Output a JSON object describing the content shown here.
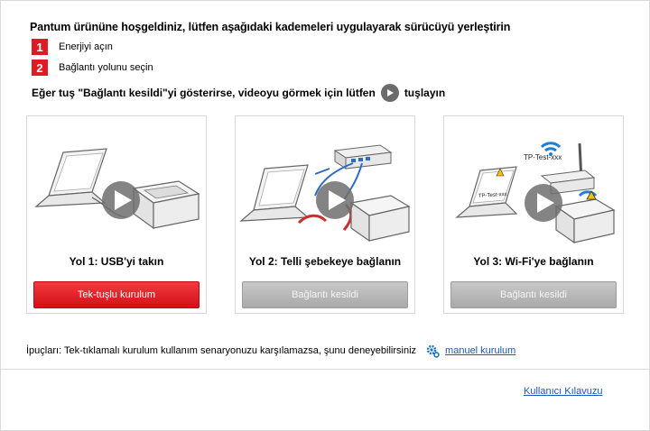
{
  "header": {
    "welcome": "Pantum ürününe hoşgeldiniz, lütfen aşağıdaki kademeleri uygulayarak sürücüyü  yerleştirin",
    "steps": [
      {
        "num": "1",
        "label": "Enerjiyi açın"
      },
      {
        "num": "2",
        "label": "Bağlantı yolunu seçin"
      }
    ],
    "note_before": "Eğer tuş \"Bağlantı kesildi\"yi gösterirse, videoyu görmek için lütfen",
    "note_after": "tuşlayın"
  },
  "cards": [
    {
      "title": "Yol 1: USB'yi takın",
      "button": "Tek-tuşlu kurulum",
      "state": "active"
    },
    {
      "title": "Yol 2: Telli şebekeye bağlanın",
      "button": "Bağlantı kesildi",
      "state": "disabled"
    },
    {
      "title": "Yol 3: Wi-Fi'ye bağlanın",
      "button": "Bağlantı kesildi",
      "state": "disabled",
      "router_label": "TP-Test-xxx",
      "laptop_screen_label": "TP-Test-xxx"
    }
  ],
  "tips": {
    "text": "İpuçları: Tek-tıklamalı kurulum kullanım senaryonuzu karşılamazsa, şunu deneyebilirsiniz",
    "link": "manuel kurulum"
  },
  "footer": {
    "manual_link": "Kullanıcı Kılavuzu"
  },
  "colors": {
    "accent": "#e01a22",
    "link": "#1a57b8",
    "disabled": "#b5b5b5"
  }
}
